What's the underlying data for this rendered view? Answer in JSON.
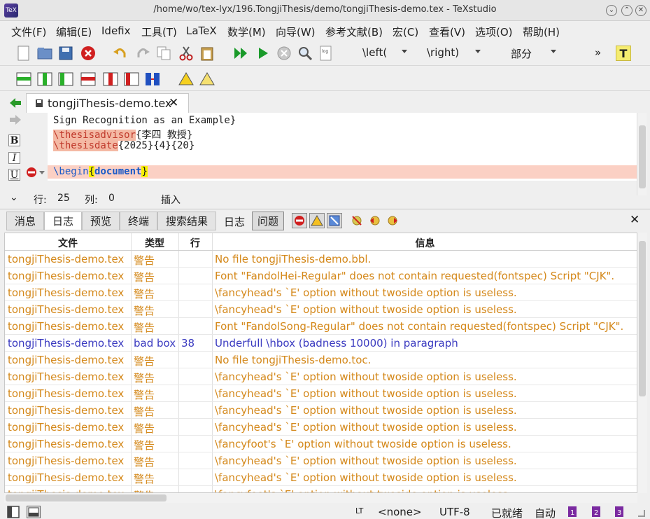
{
  "window": {
    "title": "/home/wo/tex-lyx/196.TongjiThesis/demo/tongjiThesis-demo.tex - TeXstudio",
    "icon_label": "TeX"
  },
  "menu": [
    "文件(F)",
    "编辑(E)",
    "Idefix",
    "工具(T)",
    "LaTeX",
    "数学(M)",
    "向导(W)",
    "参考文献(B)",
    "宏(C)",
    "查看(V)",
    "选项(O)",
    "帮助(H)"
  ],
  "toolbar": {
    "left_combo": "\\left(",
    "right_combo": "\\right)",
    "section_combo": "部分",
    "overflow": "»",
    "t_button": "T"
  },
  "document_tab": {
    "label": "tongjiThesis-demo.tex",
    "close": "✕"
  },
  "editor": {
    "line1": "Sign Recognition as an Example}",
    "line2_cmd": "\\thesisadvisor",
    "line2_arg": "{李四 教授}",
    "line3_cmd": "\\thesisdate",
    "line3_arg": "{2025}{4}{20}",
    "line5_cmd": "\\begin",
    "line5_brace_open": "{",
    "line5_env": "document",
    "line5_brace_close": "}"
  },
  "editor_side": {
    "bold": "B",
    "italic": "I",
    "underline": "U"
  },
  "status_line": {
    "collapse": "⌄",
    "row_label": "行:",
    "row_value": "25",
    "col_label": "列:",
    "col_value": "0",
    "mode": "插入"
  },
  "panel_tabs": [
    "消息",
    "日志",
    "预览",
    "终端",
    "搜索结果",
    "日志",
    "问题"
  ],
  "panel_close": "✕",
  "log_table": {
    "headers": [
      "文件",
      "类型",
      "行",
      "信息"
    ],
    "rows": [
      {
        "file": "tongjiThesis-demo.tex",
        "type": "警告",
        "line": "",
        "info": "No file tongjiThesis-demo.bbl.",
        "kind": "warn"
      },
      {
        "file": "tongjiThesis-demo.tex",
        "type": "警告",
        "line": "",
        "info": "Font \"FandolHei-Regular\" does not contain requested(fontspec) Script \"CJK\".",
        "kind": "warn"
      },
      {
        "file": "tongjiThesis-demo.tex",
        "type": "警告",
        "line": "",
        "info": "\\fancyhead's `E' option without twoside option is useless.",
        "kind": "warn"
      },
      {
        "file": "tongjiThesis-demo.tex",
        "type": "警告",
        "line": "",
        "info": "\\fancyhead's `E' option without twoside option is useless.",
        "kind": "warn"
      },
      {
        "file": "tongjiThesis-demo.tex",
        "type": "警告",
        "line": "",
        "info": "Font \"FandolSong-Regular\" does not contain requested(fontspec) Script \"CJK\".",
        "kind": "warn"
      },
      {
        "file": "tongjiThesis-demo.tex",
        "type": "bad box",
        "line": "38",
        "info": "Underfull \\hbox (badness 10000) in paragraph",
        "kind": "bad"
      },
      {
        "file": "tongjiThesis-demo.tex",
        "type": "警告",
        "line": "",
        "info": "No file tongjiThesis-demo.toc.",
        "kind": "warn"
      },
      {
        "file": "tongjiThesis-demo.tex",
        "type": "警告",
        "line": "",
        "info": "\\fancyhead's `E' option without twoside option is useless.",
        "kind": "warn"
      },
      {
        "file": "tongjiThesis-demo.tex",
        "type": "警告",
        "line": "",
        "info": "\\fancyhead's `E' option without twoside option is useless.",
        "kind": "warn"
      },
      {
        "file": "tongjiThesis-demo.tex",
        "type": "警告",
        "line": "",
        "info": "\\fancyhead's `E' option without twoside option is useless.",
        "kind": "warn"
      },
      {
        "file": "tongjiThesis-demo.tex",
        "type": "警告",
        "line": "",
        "info": "\\fancyhead's `E' option without twoside option is useless.",
        "kind": "warn"
      },
      {
        "file": "tongjiThesis-demo.tex",
        "type": "警告",
        "line": "",
        "info": "\\fancyfoot's `E' option without twoside option is useless.",
        "kind": "warn"
      },
      {
        "file": "tongjiThesis-demo.tex",
        "type": "警告",
        "line": "",
        "info": "\\fancyhead's `E' option without twoside option is useless.",
        "kind": "warn"
      },
      {
        "file": "tongjiThesis-demo.tex",
        "type": "警告",
        "line": "",
        "info": "\\fancyhead's `E' option without twoside option is useless.",
        "kind": "warn"
      },
      {
        "file": "tongjiThesis-demo.tex",
        "type": "警告",
        "line": "",
        "info": "\\fancyfoot's `E' option without twoside option is useless.",
        "kind": "warn"
      }
    ]
  },
  "statusbar": {
    "lt": "LT",
    "language": "<none>",
    "encoding": "UTF-8",
    "ready": "已就绪",
    "auto": "自动"
  },
  "colors": {
    "warning": "#d4881a",
    "badbox": "#3a3ac0",
    "highlight_line": "#fbd0c4",
    "command_bg": "#f4b9a4"
  }
}
